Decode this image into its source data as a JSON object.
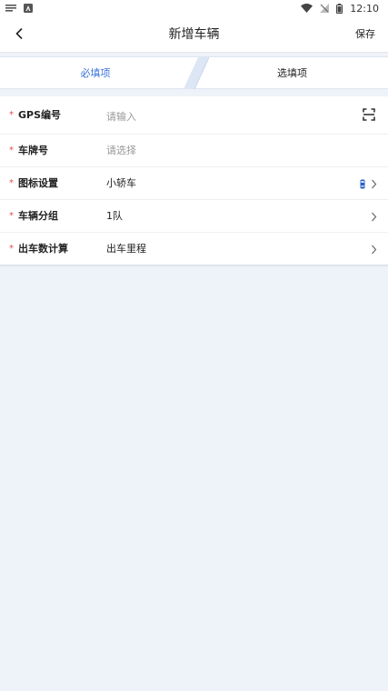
{
  "status_bar": {
    "time": "12:10",
    "icons": [
      "notification-bars-icon",
      "android-auto-icon",
      "wifi-icon",
      "signal-off-icon",
      "battery-icon"
    ]
  },
  "header": {
    "title": "新增车辆",
    "save_label": "保存",
    "back_icon": "chevron-left-icon"
  },
  "tabs": [
    {
      "label": "必填项",
      "active": true
    },
    {
      "label": "选填项",
      "active": false
    }
  ],
  "form": {
    "rows": [
      {
        "label": "GPS编号",
        "value": "请输入",
        "is_placeholder": true,
        "required": true,
        "right_icon": "scan-icon"
      },
      {
        "label": "车牌号",
        "value": "请选择",
        "is_placeholder": true,
        "required": true
      },
      {
        "label": "图标设置",
        "value": "小轿车",
        "is_placeholder": false,
        "required": true,
        "right_icon": "car-icon",
        "chevron": true
      },
      {
        "label": "车辆分组",
        "value": "1队",
        "is_placeholder": false,
        "required": true,
        "chevron": true
      },
      {
        "label": "出车数计算",
        "value": "出车里程",
        "is_placeholder": false,
        "required": true,
        "chevron": true
      }
    ],
    "required_mark": "*"
  },
  "colors": {
    "accent": "#3b74d9",
    "required": "#e0504a",
    "page_background": "#eef2f9",
    "placeholder": "#999999"
  }
}
